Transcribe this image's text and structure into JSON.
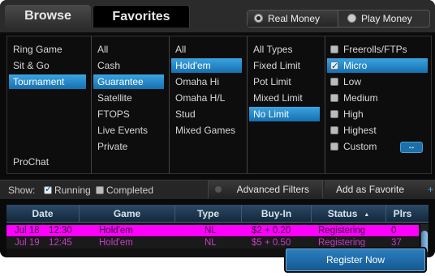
{
  "tabs": {
    "browse": "Browse",
    "favorites": "Favorites"
  },
  "money": {
    "real": "Real Money",
    "play": "Play Money",
    "selected": "real"
  },
  "filters": {
    "game": [
      "Ring Game",
      "Sit & Go",
      "Tournament",
      "ProChat"
    ],
    "game_selected": "Tournament",
    "category": [
      "All",
      "Cash",
      "Guarantee",
      "Satellite",
      "FTOPS",
      "Live Events",
      "Private"
    ],
    "category_selected": "Guarantee",
    "variant": [
      "All",
      "Hold'em",
      "Omaha Hi",
      "Omaha H/L",
      "Stud",
      "Mixed Games"
    ],
    "variant_selected": "Hold'em",
    "limit": [
      "All Types",
      "Fixed Limit",
      "Pot Limit",
      "Mixed Limit",
      "No Limit"
    ],
    "limit_selected": "No Limit",
    "stakes": [
      {
        "label": "Freerolls/FTPs",
        "checked": false
      },
      {
        "label": "Micro",
        "checked": true
      },
      {
        "label": "Low",
        "checked": false
      },
      {
        "label": "Medium",
        "checked": false
      },
      {
        "label": "High",
        "checked": false
      },
      {
        "label": "Highest",
        "checked": false
      },
      {
        "label": "Custom",
        "checked": false
      }
    ],
    "custom_icon": "wrench-icon"
  },
  "showbar": {
    "label": "Show:",
    "running": {
      "label": "Running",
      "checked": true
    },
    "completed": {
      "label": "Completed",
      "checked": false
    },
    "advanced": "Advanced Filters",
    "favorite": "Add as Favorite",
    "favorite_plus": "+"
  },
  "table": {
    "headers": {
      "date": "Date",
      "game": "Game",
      "type": "Type",
      "buyin": "Buy-In",
      "status": "Status",
      "plrs": "Plrs"
    },
    "sort_column": "status",
    "rows": [
      {
        "date": "Jul 18",
        "time": "12:30",
        "game": "Hold'em",
        "type": "NL",
        "buyin": "$2 + 0.20",
        "status": "Registering",
        "plrs": "0"
      },
      {
        "date": "Jul 19",
        "time": "12:45",
        "game": "Hold'em",
        "type": "NL",
        "buyin": "$5 + 0.50",
        "status": "Registering",
        "plrs": "37"
      }
    ]
  },
  "register_button": "Register Now",
  "colors": {
    "selected_blue": "#1f86cf",
    "highlight_row": "#ff00ff",
    "row_text": "#c040c0"
  }
}
